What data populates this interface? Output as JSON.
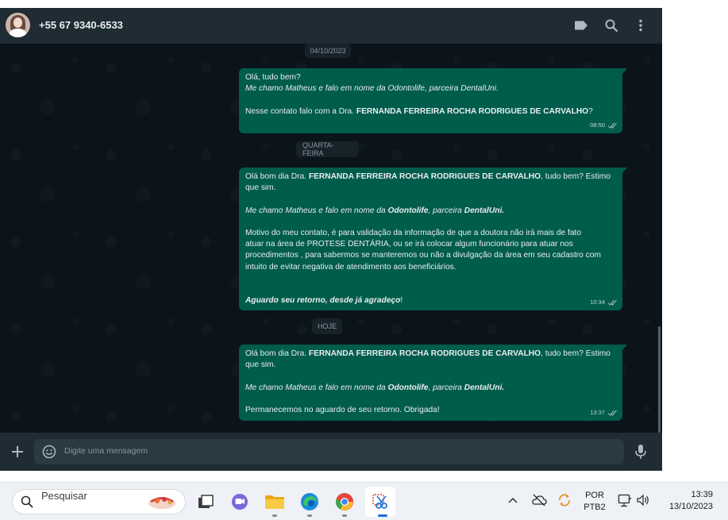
{
  "header": {
    "contact_name": "+55 67 9340-6533",
    "icons": [
      "label-icon",
      "search-icon",
      "more-vertical-icon"
    ]
  },
  "chat": {
    "date_chips": [
      "04/10/2023",
      "QUARTA-FEIRA",
      "HOJE"
    ],
    "messages": [
      {
        "time": "08:50",
        "status": "read",
        "lines": [
          "Olá, tudo bem?",
          "Me chamo Matheus e falo em nome da Odontolife, parceira DentalUni.",
          "",
          [
            "Nesse contato falo com a Dra. ",
            "FERNANDA FERREIRA ROCHA RODRIGUES DE CARVALHO",
            "?"
          ]
        ]
      },
      {
        "time": "10:34",
        "status": "read",
        "lines": [
          [
            "Olá bom dia Dra. ",
            "FERNANDA FERREIRA ROCHA RODRIGUES DE CARVALHO",
            ", tudo bem? Estimo"
          ],
          "que sim.",
          "",
          [
            "Me chamo Matheus e falo em nome da ",
            "Odontolife",
            ", parceira ",
            "DentalUni."
          ],
          "",
          "Motivo do meu contato, é para validação da informação de que a doutora não irá mais de fato",
          "atuar na área de PROTESE DENTÁRIA, ou se irá colocar algum funcionário para atuar nos",
          "procedimentos , para sabermos se manteremos ou não a divulgação da área em seu cadastro com",
          "intuito de evitar negativa de atendimento aos beneficiários.",
          "",
          "",
          [
            "Aguardo seu retorno, desde já agradeço",
            "!"
          ]
        ]
      },
      {
        "time": "13:37",
        "status": "read",
        "lines": [
          [
            "Olá bom dia Dra. ",
            "FERNANDA FERREIRA ROCHA RODRIGUES DE CARVALHO",
            ", tudo bem? Estimo"
          ],
          "que sim.",
          "",
          [
            "Me chamo Matheus e falo em nome da ",
            "Odontolife",
            ", parceira ",
            "DentalUni."
          ],
          "",
          "Permanecemos no aguardo de seu retorno. Obrigada!"
        ]
      }
    ]
  },
  "composer": {
    "placeholder": "Digite uma mensagem"
  },
  "taskbar": {
    "search_placeholder": "Pesquisar",
    "apps": [
      "task-view-icon",
      "teams-chat-icon",
      "file-explorer-icon",
      "edge-icon",
      "chrome-icon",
      "snipping-tool-icon"
    ],
    "language_line1": "POR",
    "language_line2": "PTB2",
    "time": "13:39",
    "date": "13/10/2023"
  },
  "colors": {
    "chat_bg": "#0b141a",
    "header_bg": "#202c33",
    "outgoing_bubble": "#005c4b",
    "read_ticks": "#9fb8b1"
  }
}
